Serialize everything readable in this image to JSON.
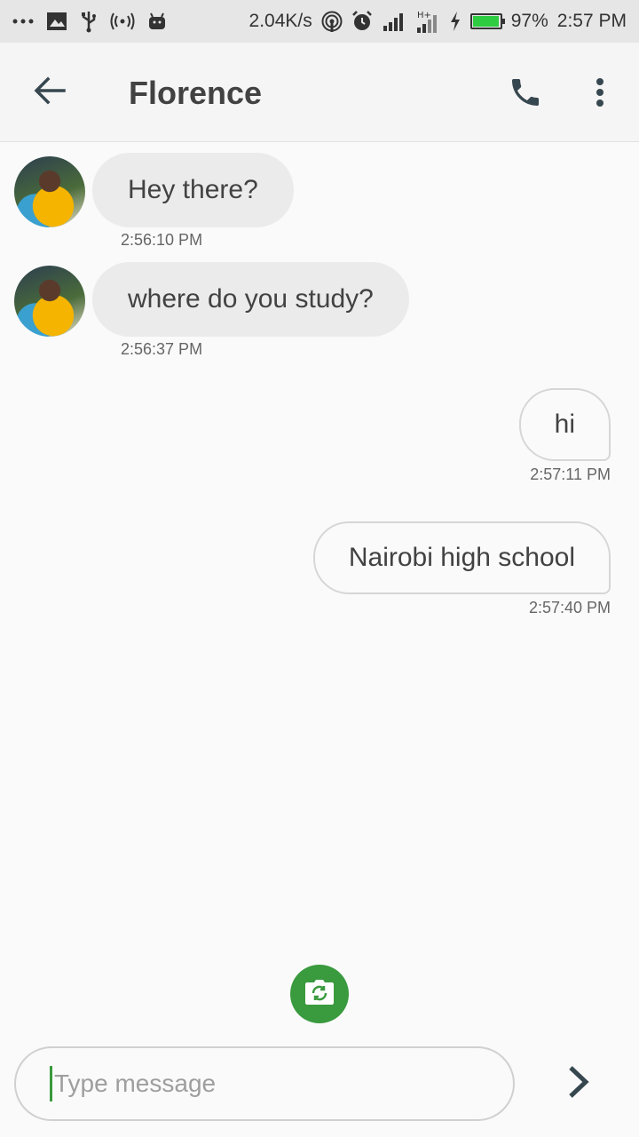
{
  "status_bar": {
    "net_speed": "2.04K/s",
    "battery_pct": "97%",
    "time": "2:57 PM",
    "battery_level": 0.97,
    "icons": [
      "more-dots-icon",
      "image-icon",
      "usb-icon",
      "hotspot-icon",
      "android-icon",
      "wifi-hotspot-icon",
      "alarm-icon",
      "signal-icon",
      "signal-hplus-icon",
      "charging-icon",
      "battery-icon"
    ]
  },
  "header": {
    "title": "Florence",
    "icons": [
      "back-arrow-icon",
      "phone-icon",
      "more-vert-icon"
    ]
  },
  "messages": [
    {
      "direction": "incoming",
      "text": "Hey there?",
      "time": "2:56:10 PM"
    },
    {
      "direction": "incoming",
      "text": "where do you study?",
      "time": "2:56:37 PM"
    },
    {
      "direction": "outgoing",
      "text": "hi",
      "time": "2:57:11 PM"
    },
    {
      "direction": "outgoing",
      "text": "Nairobi high school",
      "time": "2:57:40 PM"
    }
  ],
  "composer": {
    "placeholder": "Type message"
  },
  "colors": {
    "accent": "#3a9a3e",
    "incoming_bubble": "#ebebeb",
    "outgoing_border": "#d6d6d6",
    "icon_dark": "#37474f"
  }
}
